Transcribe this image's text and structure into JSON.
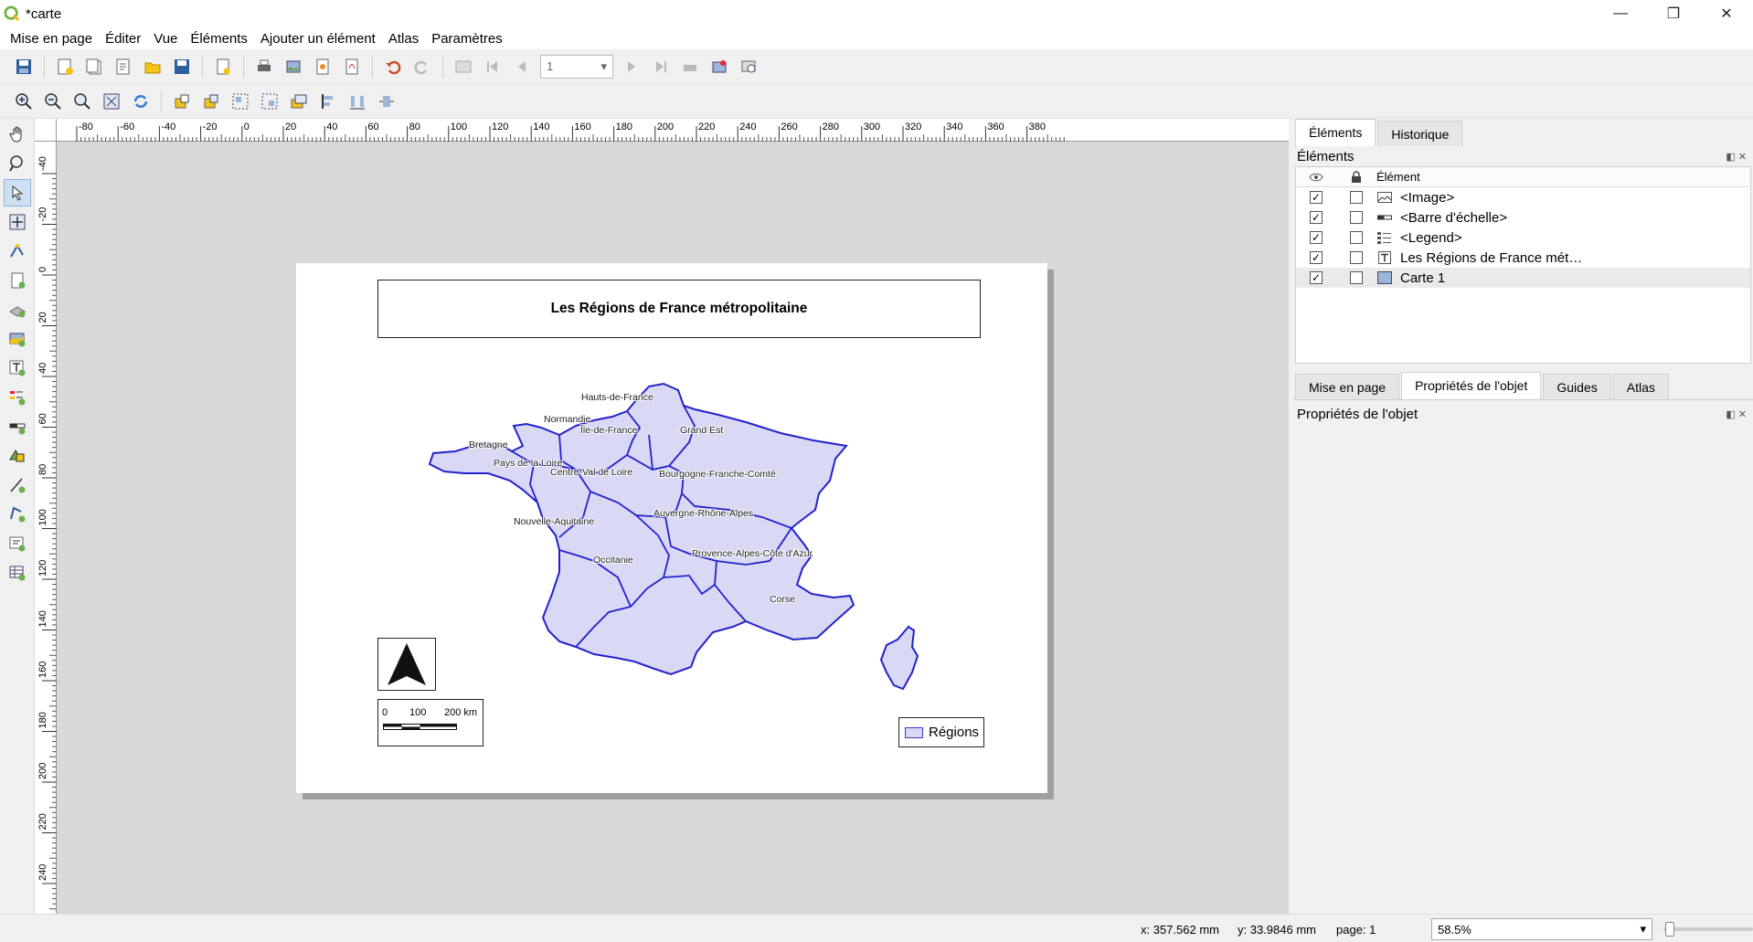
{
  "window": {
    "title": "*carte",
    "minimize": "—",
    "restore": "❐",
    "close": "✕"
  },
  "menu": [
    "Mise en page",
    "Éditer",
    "Vue",
    "Éléments",
    "Ajouter un élément",
    "Atlas",
    "Paramètres"
  ],
  "toolbar": {
    "page_number": "1"
  },
  "ruler": {
    "h_ticks": [
      "-80",
      "-60",
      "-40",
      "-20",
      "0",
      "20",
      "40",
      "60",
      "80",
      "100",
      "120",
      "140",
      "160",
      "180",
      "200",
      "220",
      "240",
      "260",
      "280",
      "300",
      "320",
      "340",
      "360",
      "380"
    ],
    "v_ticks": [
      "-40",
      "-20",
      "0",
      "20",
      "40",
      "60",
      "80",
      "100",
      "120",
      "140",
      "160",
      "180",
      "200",
      "220",
      "240"
    ]
  },
  "layout": {
    "title": "Les Régions de France métropolitaine",
    "scale_labels": [
      "0",
      "100",
      "200 km"
    ],
    "legend_label": "Régions",
    "regions": [
      "Hauts-de-France",
      "Normandie",
      "Île-de-France",
      "Grand Est",
      "Bretagne",
      "Pays de la Loire",
      "Centre-Val de Loire",
      "Bourgogne-Franche-Comté",
      "Auvergne-Rhône-Alpes",
      "Nouvelle-Aquitaine",
      "Occitanie",
      "Provence-Alpes-Côte d'Azur",
      "Corse"
    ]
  },
  "panel": {
    "tabs_top": [
      "Éléments",
      "Historique"
    ],
    "items_header": "Éléments",
    "col_element": "Élément",
    "items": [
      {
        "label": "<Image>",
        "visible": true,
        "locked": false,
        "icon": "image-icon"
      },
      {
        "label": "<Barre d'échelle>",
        "visible": true,
        "locked": false,
        "icon": "scalebar-icon"
      },
      {
        "label": "<Legend>",
        "visible": true,
        "locked": false,
        "icon": "legend-icon"
      },
      {
        "label": "Les Régions de France mét…",
        "visible": true,
        "locked": false,
        "icon": "text-icon"
      },
      {
        "label": "Carte 1",
        "visible": true,
        "locked": false,
        "icon": "map-icon"
      }
    ],
    "tabs_bottom": [
      "Mise en page",
      "Propriétés de l'objet",
      "Guides",
      "Atlas"
    ],
    "props_header": "Propriétés de l'objet"
  },
  "status": {
    "x": "x: 357.562 mm",
    "y": "y: 33.9846 mm",
    "page": "page: 1",
    "zoom": "58.5%"
  }
}
